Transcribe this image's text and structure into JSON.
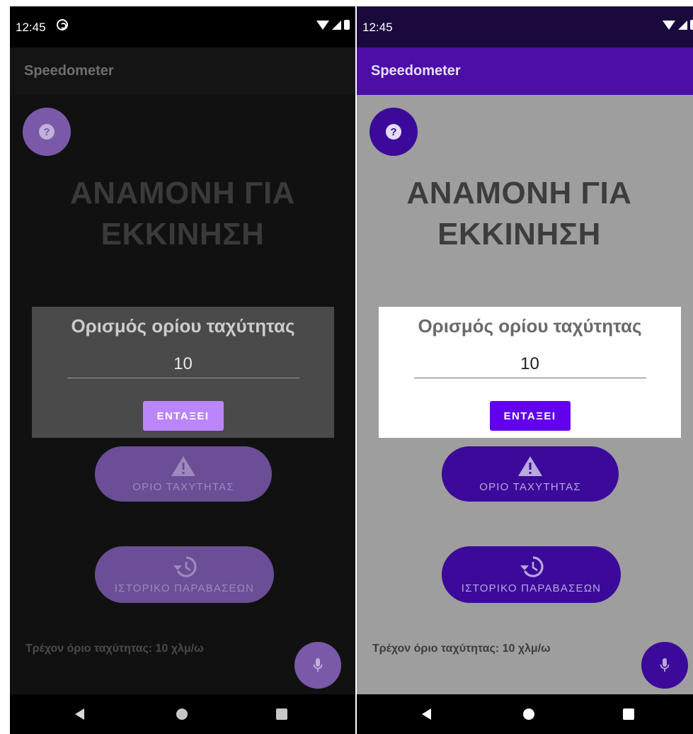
{
  "screens": {
    "dark": {
      "status_time": "12:45",
      "app_title": "Speedometer",
      "status_heading_line1": "ΑΝΑΜΟΝΗ ΓΙΑ",
      "status_heading_line2": "ΕΚΚΙΝΗΣΗ",
      "speed_limit_button_label": "ΟΡΙΟ ΤΑΧΥΤΗΤΑΣ",
      "history_button_label": "ΙΣΤΟΡΙΚΟ ΠΑΡΑΒΑΣΕΩΝ",
      "current_limit_text": "Τρέχον όριο ταχύτητας: 10 χλμ/ω",
      "dialog": {
        "title": "Ορισμός ορίου ταχύτητας",
        "input_value": "10",
        "ok_label": "ΕΝΤΑΞΕΙ"
      }
    },
    "light": {
      "status_time": "12:45",
      "app_title": "Speedometer",
      "status_heading_line1": "ΑΝΑΜΟΝΗ ΓΙΑ",
      "status_heading_line2": "ΕΚΚΙΝΗΣΗ",
      "speed_limit_button_label": "ΟΡΙΟ ΤΑΧΥΤΗΤΑΣ",
      "history_button_label": "ΙΣΤΟΡΙΚΟ ΠΑΡΑΒΑΣΕΩΝ",
      "current_limit_text": "Τρέχον όριο ταχύτητας: 10 χλμ/ω",
      "dialog": {
        "title": "Ορισμός ορίου ταχύτητας",
        "input_value": "10",
        "ok_label": "ΕΝΤΑΞΕΙ"
      }
    }
  },
  "icons": {
    "status_extra": "at-sign-icon",
    "wifi": "wifi-icon",
    "signal": "cell-signal-icon",
    "battery": "battery-icon",
    "help": "help-icon",
    "warning": "warning-icon",
    "history": "history-icon",
    "mic": "microphone-icon",
    "back": "back-icon",
    "home": "home-icon",
    "recent": "recent-apps-icon"
  },
  "colors": {
    "primary": "#6200ee",
    "primary_dark_theme": "#bb86fc",
    "app_bar_light": "#4c0ea6"
  }
}
